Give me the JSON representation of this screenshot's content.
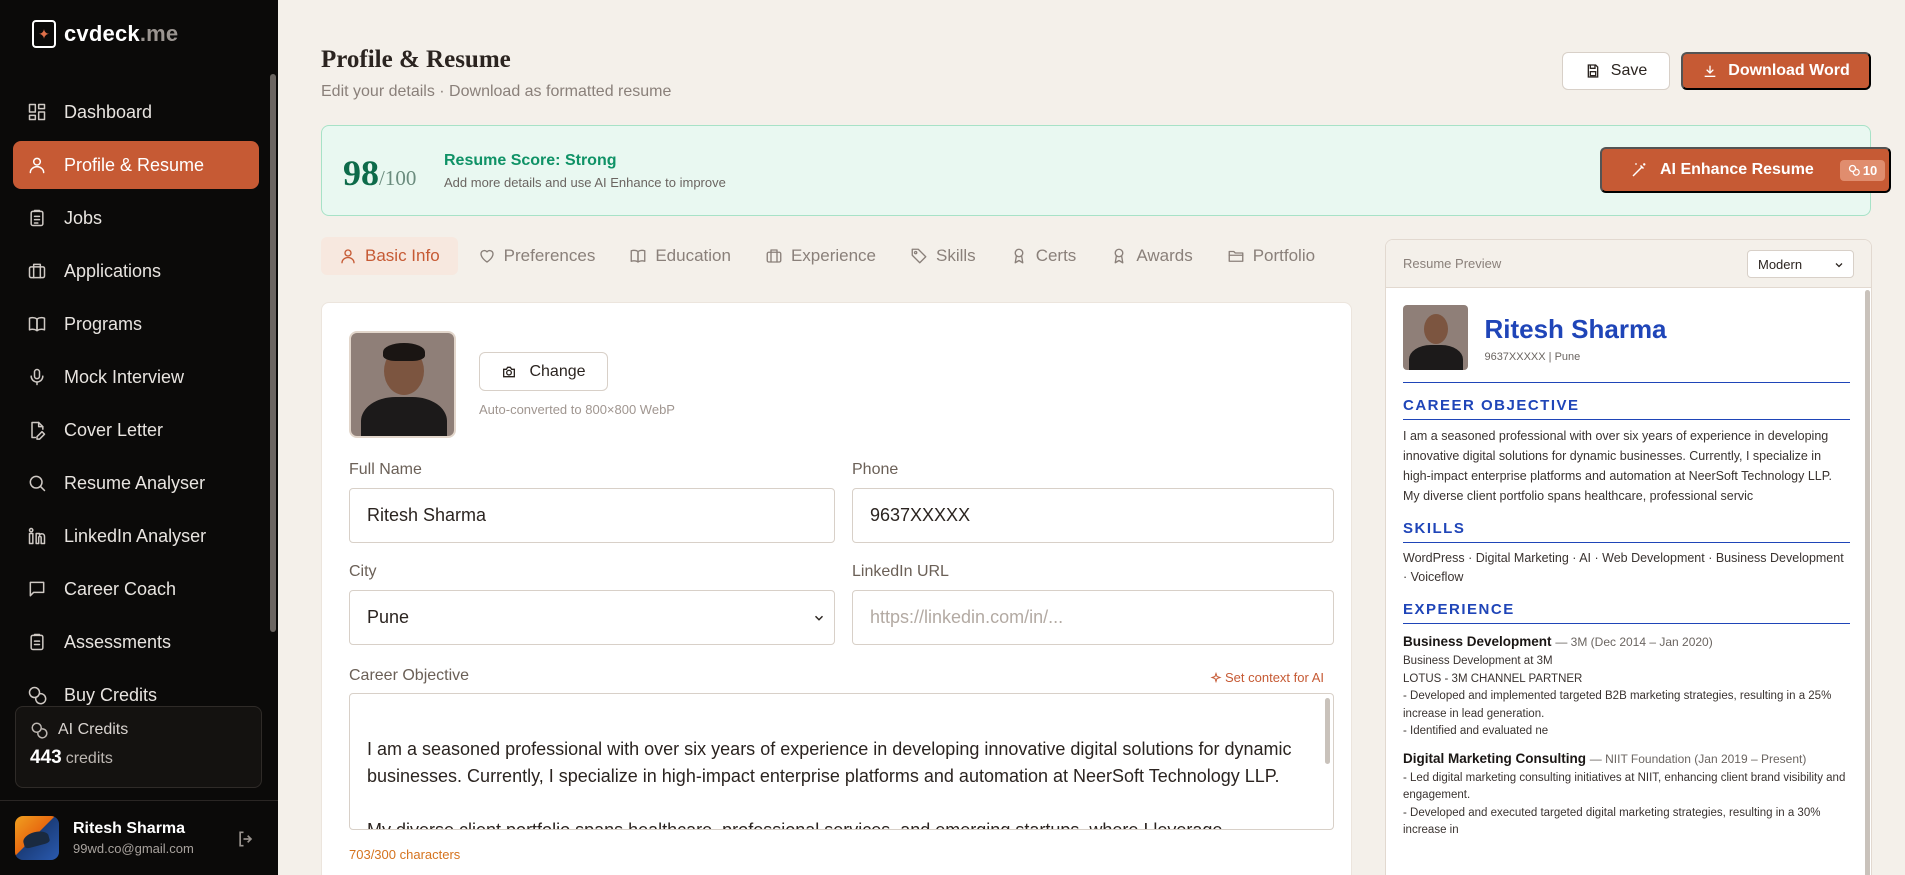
{
  "brand": {
    "name": "cvdeck",
    "tld": ".me"
  },
  "nav": [
    {
      "label": "Dashboard",
      "icon": "dashboard-icon",
      "active": false
    },
    {
      "label": "Profile & Resume",
      "icon": "user-icon",
      "active": true
    },
    {
      "label": "Jobs",
      "icon": "clipboard-icon",
      "active": false
    },
    {
      "label": "Applications",
      "icon": "briefcase-icon",
      "active": false
    },
    {
      "label": "Programs",
      "icon": "book-icon",
      "active": false
    },
    {
      "label": "Mock Interview",
      "icon": "mic-icon",
      "active": false
    },
    {
      "label": "Cover Letter",
      "icon": "file-edit-icon",
      "active": false
    },
    {
      "label": "Resume Analyser",
      "icon": "search-icon",
      "active": false
    },
    {
      "label": "LinkedIn Analyser",
      "icon": "linkedin-icon",
      "active": false
    },
    {
      "label": "Career Coach",
      "icon": "message-icon",
      "active": false
    },
    {
      "label": "Assessments",
      "icon": "clipboard-check-icon",
      "active": false
    },
    {
      "label": "Buy Credits",
      "icon": "coins-icon",
      "active": false
    }
  ],
  "credits": {
    "title": "AI Credits",
    "value": "443",
    "unit": "credits"
  },
  "user": {
    "name": "Ritesh Sharma",
    "email": "99wd.co@gmail.com"
  },
  "header": {
    "title": "Profile & Resume",
    "subtitle": "Edit your details · Download as formatted resume",
    "save_label": "Save",
    "download_label": "Download Word"
  },
  "score": {
    "value": "98",
    "max": "/100",
    "title": "Resume Score: Strong",
    "hint": "Add more details and use AI Enhance to improve",
    "ai_button": "AI Enhance Resume",
    "ai_cost": "10"
  },
  "tabs": [
    {
      "label": "Basic Info",
      "icon": "user-icon",
      "active": true
    },
    {
      "label": "Preferences",
      "icon": "heart-icon",
      "active": false
    },
    {
      "label": "Education",
      "icon": "book-icon",
      "active": false
    },
    {
      "label": "Experience",
      "icon": "briefcase-icon",
      "active": false
    },
    {
      "label": "Skills",
      "icon": "tag-icon",
      "active": false
    },
    {
      "label": "Certs",
      "icon": "award-icon",
      "active": false
    },
    {
      "label": "Awards",
      "icon": "award-icon",
      "active": false
    },
    {
      "label": "Portfolio",
      "icon": "folder-icon",
      "active": false
    }
  ],
  "form": {
    "change_label": "Change",
    "photo_hint": "Auto-converted to 800×800 WebP",
    "full_name_label": "Full Name",
    "full_name_value": "Ritesh Sharma",
    "phone_label": "Phone",
    "phone_value": "9637XXXXX",
    "city_label": "City",
    "city_value": "Pune",
    "linkedin_label": "LinkedIn URL",
    "linkedin_placeholder": "https://linkedin.com/in/...",
    "objective_label": "Career Objective",
    "set_context": "Set context for AI",
    "objective_value": "I am a seasoned professional with over six years of experience in developing innovative digital solutions for dynamic businesses. Currently, I specialize in high-impact enterprise platforms and automation at NeerSoft Technology LLP.\n\nMy diverse client portfolio spans healthcare, professional services, and emerging startups, where I leverage",
    "char_count": "703/300 characters"
  },
  "preview": {
    "label": "Resume Preview",
    "template": "Modern",
    "name": "Ritesh Sharma",
    "contact": "9637XXXXX | Pune",
    "objective_heading": "CAREER OBJECTIVE",
    "objective_text": "I am a seasoned professional with over six years of experience in developing innovative digital solutions for dynamic businesses. Currently, I specialize in high-impact enterprise platforms and automation at NeerSoft Technology LLP. My diverse client portfolio spans healthcare, professional servic",
    "skills_heading": "SKILLS",
    "skills_text": "WordPress · Digital Marketing · AI · Web Development · Business Development · Voiceflow",
    "experience_heading": "EXPERIENCE",
    "jobs": [
      {
        "title": "Business Development",
        "meta": "— 3M (Dec 2014 – Jan 2020)",
        "lines": [
          "Business Development at 3M",
          "LOTUS - 3M CHANNEL PARTNER",
          "- Developed and implemented targeted B2B marketing strategies, resulting in a 25% increase in lead generation.",
          "- Identified and evaluated ne"
        ]
      },
      {
        "title": "Digital Marketing Consulting",
        "meta": "— NIIT Foundation (Jan 2019 – Present)",
        "lines": [
          "- Led digital marketing consulting initiatives at NIIT, enhancing client brand visibility and engagement.",
          "- Developed and executed targeted digital marketing strategies, resulting in a 30% increase in"
        ]
      }
    ]
  },
  "colors": {
    "accent": "#c65a34",
    "sidebar_bg": "#0b0a09",
    "score_green": "#0f9266",
    "preview_blue": "#1f45b8"
  }
}
